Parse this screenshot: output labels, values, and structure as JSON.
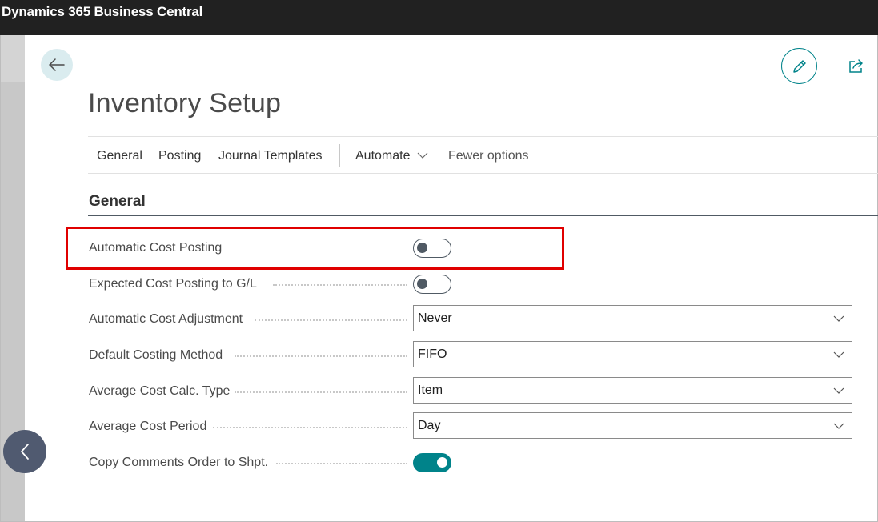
{
  "app": {
    "title": "Dynamics 365 Business Central"
  },
  "page": {
    "title": "Inventory Setup"
  },
  "icons": {
    "back": "arrow-left-icon",
    "edit": "pencil-icon",
    "share": "share-icon",
    "collapse": "chevron-left-icon",
    "dropdown": "chevron-down-icon"
  },
  "colors": {
    "accent": "#00838a",
    "titlebar": "#212121",
    "highlight": "#e00000"
  },
  "menu": {
    "general": "General",
    "posting": "Posting",
    "journal_templates": "Journal Templates",
    "automate": "Automate",
    "fewer_options": "Fewer options"
  },
  "section": {
    "title": "General"
  },
  "fields": [
    {
      "label": "Automatic Cost Posting",
      "type": "toggle",
      "value": false
    },
    {
      "label": "Expected Cost Posting to G/L",
      "type": "toggle",
      "value": false
    },
    {
      "label": "Automatic Cost Adjustment",
      "type": "select",
      "value": "Never"
    },
    {
      "label": "Default Costing Method",
      "type": "select",
      "value": "FIFO"
    },
    {
      "label": "Average Cost Calc. Type",
      "type": "select",
      "value": "Item"
    },
    {
      "label": "Average Cost Period",
      "type": "select",
      "value": "Day"
    },
    {
      "label": "Copy Comments Order to Shpt.",
      "type": "toggle",
      "value": true
    }
  ]
}
